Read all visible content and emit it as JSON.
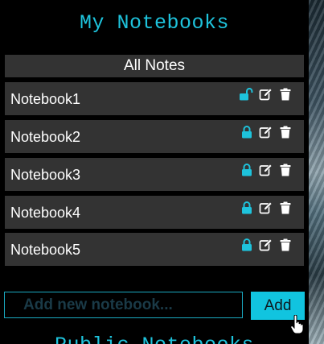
{
  "sidebar": {
    "title": "My Notebooks",
    "all_notes_label": "All Notes",
    "notebooks": [
      {
        "label": "Notebook1",
        "lock_state": "unlocked"
      },
      {
        "label": "Notebook2",
        "lock_state": "locked"
      },
      {
        "label": "Notebook3",
        "lock_state": "locked"
      },
      {
        "label": "Notebook4",
        "lock_state": "locked"
      },
      {
        "label": "Notebook5",
        "lock_state": "locked"
      }
    ],
    "add_form": {
      "placeholder": "Add new notebook...",
      "value": "",
      "button_label": "Add"
    },
    "public_title": "Public Notebooks"
  },
  "colors": {
    "accent": "#1ec3dc",
    "row_bg": "#333333",
    "page_bg": "#000000",
    "button_bg": "#11c4df"
  },
  "icons": [
    "lock-icon",
    "unlock-icon",
    "edit-icon",
    "trash-icon",
    "hand-cursor-icon"
  ]
}
